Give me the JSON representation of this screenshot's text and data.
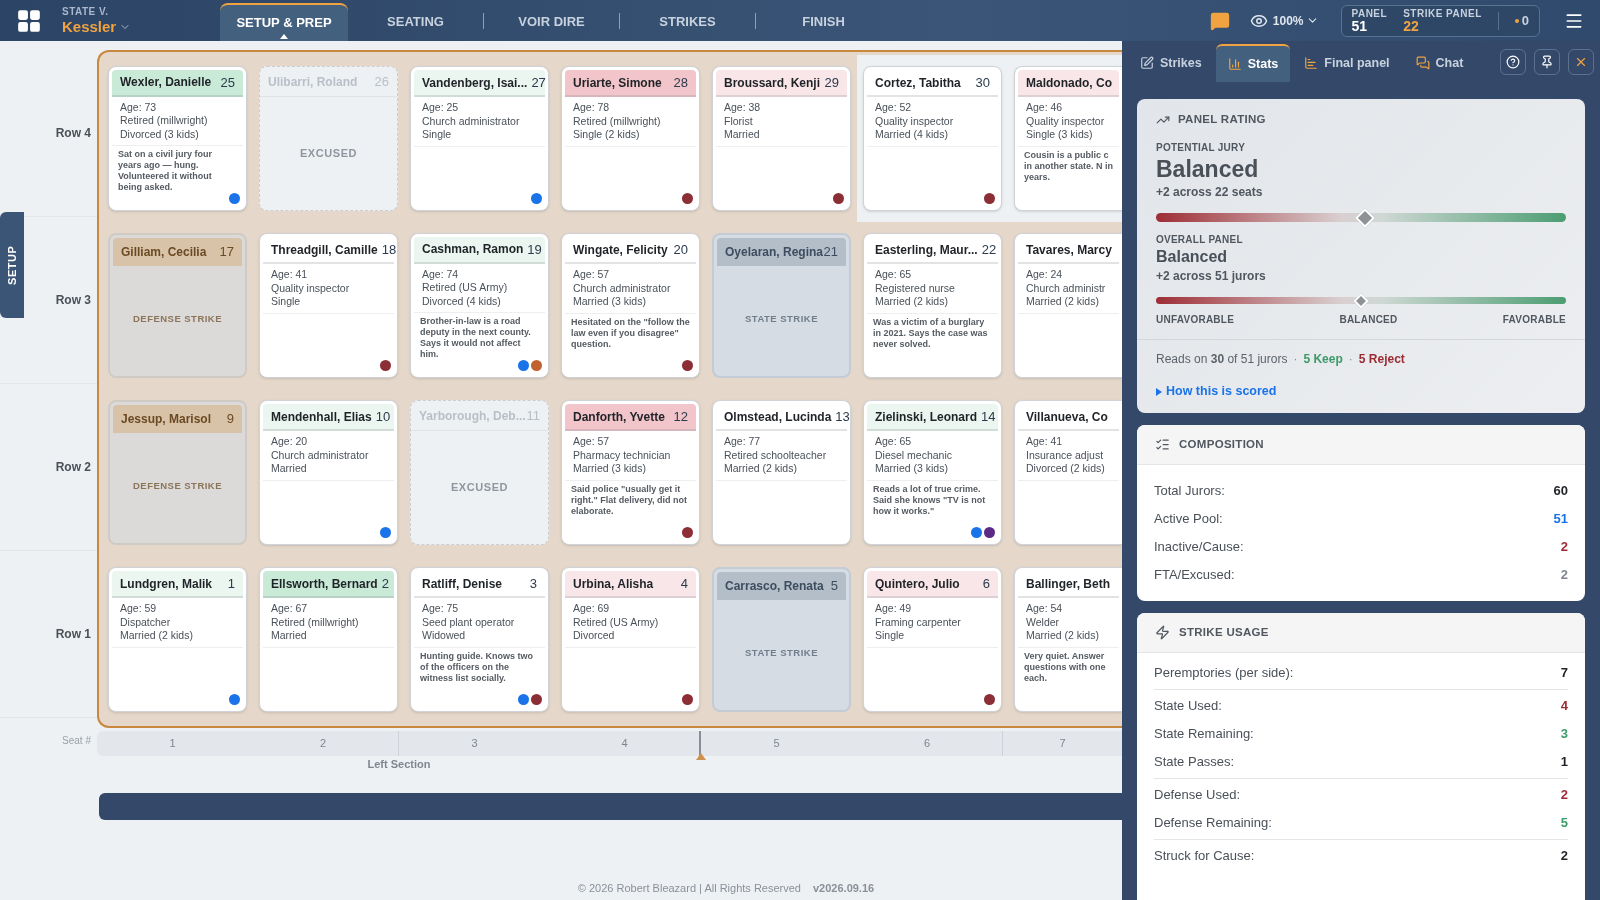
{
  "case": {
    "caption": "STATE V.",
    "name": "Kessler"
  },
  "steps": [
    {
      "label": "SETUP & PREP",
      "selected": true
    },
    {
      "label": "SEATING",
      "selected": false
    },
    {
      "label": "VOIR DIRE",
      "selected": false
    },
    {
      "label": "STRIKES",
      "selected": false
    },
    {
      "label": "FINISH",
      "selected": false
    }
  ],
  "zoom": "100%",
  "counters": [
    {
      "label": "PANEL",
      "value": "51",
      "color": "#ffffff"
    },
    {
      "label": "STRIKE PANEL",
      "value": "22",
      "color": "#f0a340"
    }
  ],
  "alerts": "0",
  "side_tab": "SETUP",
  "rows": [
    {
      "label": "Row 4",
      "seats": [
        {
          "kind": "juror",
          "name": "Wexler, Danielle",
          "number": "25",
          "color": "#c9ead7",
          "in_section": true,
          "details": [
            "Age: 73",
            "Retired (millwright)",
            "Divorced (3 kids)"
          ],
          "note": "Sat on a civil jury four years ago — hung. Volunteered it without being asked.",
          "dots": [
            {
              "color": "#1a73e8"
            }
          ]
        },
        {
          "kind": "excused",
          "name": "Ulibarri, Roland",
          "number": "26",
          "in_section": true,
          "status": "EXCUSED"
        },
        {
          "kind": "juror",
          "name": "Vandenberg, Isai...",
          "number": "27",
          "color": "#eaf6ef",
          "in_section": true,
          "details": [
            "Age: 25",
            "Church administrator",
            "Single"
          ],
          "dots": [
            {
              "color": "#1a73e8"
            }
          ]
        },
        {
          "kind": "juror",
          "name": "Uriarte, Simone",
          "number": "28",
          "color": "#f1c5ca",
          "in_section": true,
          "details": [
            "Age: 78",
            "Retired (millwright)",
            "Single (2 kids)"
          ],
          "dots": [
            {
              "color": "#8b2e35"
            }
          ]
        },
        {
          "kind": "juror",
          "name": "Broussard, Kenji",
          "number": "29",
          "color": "#f9e6e8",
          "in_section": true,
          "details": [
            "Age: 38",
            "Florist",
            "Married"
          ],
          "dots": [
            {
              "color": "#8b2e35"
            }
          ]
        },
        {
          "kind": "juror",
          "name": "Cortez, Tabitha",
          "number": "30",
          "color": "#ffffff",
          "in_section": false,
          "details": [
            "Age: 52",
            "Quality inspector",
            "Married (4 kids)"
          ],
          "dots": [
            {
              "color": "#8b2e35"
            }
          ]
        },
        {
          "kind": "juror",
          "name": "Maldonado, Co",
          "color": "#f9e6e8",
          "in_section": false,
          "details": [
            "Age: 46",
            "Quality inspector",
            "Single (3 kids)"
          ],
          "note": "Cousin is a public c in another state. N in years."
        }
      ]
    },
    {
      "label": "Row 3",
      "seats": [
        {
          "kind": "defense_strike",
          "name": "Gilliam, Cecilia",
          "number": "17",
          "in_section": true,
          "status": "DEFENSE STRIKE"
        },
        {
          "kind": "juror",
          "name": "Threadgill, Camille",
          "number": "18",
          "color": "#ffffff",
          "in_section": true,
          "details": [
            "Age: 41",
            "Quality inspector",
            "Single"
          ],
          "dots": [
            {
              "color": "#8b2e35"
            }
          ]
        },
        {
          "kind": "juror",
          "name": "Cashman, Ramon",
          "number": "19",
          "color": "#eaf6ef",
          "in_section": true,
          "details": [
            "Age: 74",
            "Retired (US Army)",
            "Divorced (4 kids)"
          ],
          "note": "Brother-in-law is a road deputy in the next county. Says it would not affect him.",
          "dots": [
            {
              "color": "#1a73e8"
            },
            {
              "color": "#c0622f"
            }
          ]
        },
        {
          "kind": "juror",
          "name": "Wingate, Felicity",
          "number": "20",
          "color": "#ffffff",
          "in_section": true,
          "details": [
            "Age: 57",
            "Church administrator",
            "Married (3 kids)"
          ],
          "note": "Hesitated on the \"follow the law even if you disagree\" question.",
          "dots": [
            {
              "color": "#8b2e35"
            }
          ]
        },
        {
          "kind": "state_strike",
          "name": "Oyelaran, Regina",
          "number": "21",
          "in_section": true,
          "status": "STATE STRIKE"
        },
        {
          "kind": "juror",
          "name": "Easterling, Maur...",
          "number": "22",
          "color": "#ffffff",
          "in_section": true,
          "details": [
            "Age: 65",
            "Registered nurse",
            "Married (2 kids)"
          ],
          "note": "Was a victim of a burglary in 2021. Says the case was never solved."
        },
        {
          "kind": "juror",
          "name": "Tavares, Marcy",
          "color": "#ffffff",
          "in_section": true,
          "details": [
            "Age: 24",
            "Church administr",
            "Married (2 kids)"
          ]
        }
      ]
    },
    {
      "label": "Row 2",
      "seats": [
        {
          "kind": "defense_strike",
          "name": "Jessup, Marisol",
          "number": "9",
          "in_section": true,
          "status": "DEFENSE STRIKE"
        },
        {
          "kind": "juror",
          "name": "Mendenhall, Elias",
          "number": "10",
          "color": "#eaf6ef",
          "in_section": true,
          "details": [
            "Age: 20",
            "Church administrator",
            "Married"
          ],
          "dots": [
            {
              "color": "#1a73e8"
            }
          ]
        },
        {
          "kind": "excused",
          "name": "Yarborough, Deb...",
          "number": "11",
          "in_section": true,
          "status": "EXCUSED"
        },
        {
          "kind": "juror",
          "name": "Danforth, Yvette",
          "number": "12",
          "color": "#f1c5ca",
          "in_section": true,
          "details": [
            "Age: 57",
            "Pharmacy technician",
            "Married (3 kids)"
          ],
          "note": "Said police \"usually get it right.\" Flat delivery, did not elaborate.",
          "dots": [
            {
              "color": "#8b2e35"
            }
          ]
        },
        {
          "kind": "juror",
          "name": "Olmstead, Lucinda",
          "number": "13",
          "color": "#ffffff",
          "in_section": true,
          "details": [
            "Age: 77",
            "Retired schoolteacher",
            "Married (2 kids)"
          ]
        },
        {
          "kind": "juror",
          "name": "Zielinski, Leonard",
          "number": "14",
          "color": "#eaf6ef",
          "in_section": true,
          "details": [
            "Age: 65",
            "Diesel mechanic",
            "Married (3 kids)"
          ],
          "note": "Reads a lot of true crime. Said she knows \"TV is not how it works.\"",
          "dots": [
            {
              "color": "#1a73e8"
            },
            {
              "color": "#5b2a86"
            }
          ]
        },
        {
          "kind": "juror",
          "name": "Villanueva, Co",
          "color": "#ffffff",
          "in_section": true,
          "details": [
            "Age: 41",
            "Insurance adjust",
            "Divorced (2 kids)"
          ]
        }
      ]
    },
    {
      "label": "Row 1",
      "seats": [
        {
          "kind": "juror",
          "name": "Lundgren, Malik",
          "number": "1",
          "color": "#eaf6ef",
          "in_section": true,
          "details": [
            "Age: 59",
            "Dispatcher",
            "Married (2 kids)"
          ],
          "dots": [
            {
              "color": "#1a73e8"
            }
          ]
        },
        {
          "kind": "juror",
          "name": "Ellsworth, Bernard",
          "number": "2",
          "color": "#c9ead7",
          "in_section": true,
          "details": [
            "Age: 67",
            "Retired (millwright)",
            "Married"
          ]
        },
        {
          "kind": "juror",
          "name": "Ratliff, Denise",
          "number": "3",
          "color": "#ffffff",
          "in_section": true,
          "details": [
            "Age: 75",
            "Seed plant operator",
            "Widowed"
          ],
          "note": "Hunting guide. Knows two of the officers on the witness list socially.",
          "dots": [
            {
              "color": "#1a73e8"
            },
            {
              "color": "#8b2e35"
            }
          ]
        },
        {
          "kind": "juror",
          "name": "Urbina, Alisha",
          "number": "4",
          "color": "#f9e6e8",
          "in_section": true,
          "details": [
            "Age: 69",
            "Retired (US Army)",
            "Divorced"
          ],
          "dots": [
            {
              "color": "#8b2e35"
            }
          ]
        },
        {
          "kind": "state_strike",
          "name": "Carrasco, Renata",
          "number": "5",
          "in_section": true,
          "status": "STATE STRIKE"
        },
        {
          "kind": "juror",
          "name": "Quintero, Julio",
          "number": "6",
          "color": "#f9e6e8",
          "in_section": true,
          "details": [
            "Age: 49",
            "Framing carpenter",
            "Single"
          ],
          "dots": [
            {
              "color": "#8b2e35"
            }
          ]
        },
        {
          "kind": "juror",
          "name": "Ballinger, Beth",
          "color": "#ffffff",
          "in_section": true,
          "details": [
            "Age: 54",
            "Welder",
            "Married (2 kids)"
          ],
          "note": "Very quiet. Answer questions with one each."
        }
      ]
    }
  ],
  "seat_axis": {
    "label": "Seat #",
    "seats": [
      "1",
      "2",
      "3",
      "4",
      "5",
      "6",
      "7"
    ],
    "section": "Left Section"
  },
  "footer": {
    "copyright": "© 2026 Robert Bleazard | All Rights Reserved",
    "version": "v2026.09.16"
  },
  "panel": {
    "tabs": [
      {
        "label": "Strikes",
        "selected": false
      },
      {
        "label": "Stats",
        "selected": true
      },
      {
        "label": "Final panel",
        "selected": false
      },
      {
        "label": "Chat",
        "selected": false
      }
    ],
    "rating": {
      "title": "PANEL RATING",
      "measures": [
        {
          "kind": "large",
          "caption": "POTENTIAL JURY",
          "value": "Balanced",
          "detail": "+2 across 22 seats",
          "level": 0.51
        },
        {
          "kind": "small",
          "caption": "OVERALL PANEL",
          "value": "Balanced",
          "detail": "+2 across 51 jurors",
          "level": 0.5
        }
      ],
      "scale": [
        "UNFAVORABLE",
        "BALANCED",
        "FAVORABLE"
      ],
      "reads": "Reads on **30** of 51 jurors",
      "separator": "·",
      "keep": "5 Keep",
      "reject": "5 Reject",
      "link": "How this is scored"
    },
    "composition": {
      "title": "COMPOSITION",
      "rows": [
        {
          "label": "Total Jurors:",
          "value": "60",
          "color": "#1f2328"
        },
        {
          "label": "Active Pool:",
          "value": "51",
          "color": "#1a73e8"
        },
        {
          "label": "Inactive/Cause:",
          "value": "2",
          "color": "#9b2c33"
        },
        {
          "label": "FTA/Excused:",
          "value": "2",
          "color": "#80868e"
        }
      ]
    },
    "strikes": {
      "title": "STRIKE USAGE",
      "groups": [
        [
          {
            "label": "Peremptories (per side):",
            "value": "7",
            "color": "#1f2328"
          }
        ],
        [
          {
            "label": "State Used:",
            "value": "4",
            "color": "#9b2c33"
          },
          {
            "label": "State Remaining:",
            "value": "3",
            "color": "#3d9a6a"
          },
          {
            "label": "State Passes:",
            "value": "1",
            "color": "#1f2328"
          }
        ],
        [
          {
            "label": "Defense Used:",
            "value": "2",
            "color": "#9b2c33"
          },
          {
            "label": "Defense Remaining:",
            "value": "5",
            "color": "#3d9a6a"
          }
        ],
        [
          {
            "label": "Struck for Cause:",
            "value": "2",
            "color": "#1f2328"
          }
        ]
      ]
    }
  }
}
